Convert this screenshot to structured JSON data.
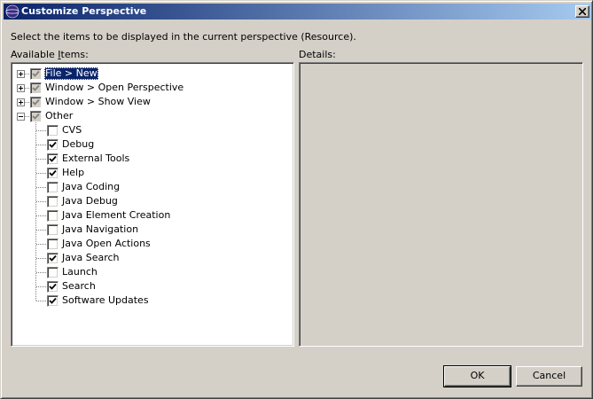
{
  "window": {
    "title": "Customize Perspective",
    "icon": "eclipse-icon"
  },
  "instructions": "Select the items to be displayed in the current perspective (Resource).",
  "available_label": "Available Items:",
  "details_label": "Details:",
  "tree": {
    "top_items": [
      {
        "label": "File > New",
        "expanded": false,
        "state": "grayed-checked",
        "selected": true
      },
      {
        "label": "Window > Open Perspective",
        "expanded": false,
        "state": "grayed-checked",
        "selected": false
      },
      {
        "label": "Window > Show View",
        "expanded": false,
        "state": "grayed-checked",
        "selected": false
      },
      {
        "label": "Other",
        "expanded": true,
        "state": "grayed-checked",
        "selected": false
      }
    ],
    "other_children": [
      {
        "label": "CVS",
        "checked": false
      },
      {
        "label": "Debug",
        "checked": true
      },
      {
        "label": "External Tools",
        "checked": true
      },
      {
        "label": "Help",
        "checked": true
      },
      {
        "label": "Java Coding",
        "checked": false
      },
      {
        "label": "Java Debug",
        "checked": false
      },
      {
        "label": "Java Element Creation",
        "checked": false
      },
      {
        "label": "Java Navigation",
        "checked": false
      },
      {
        "label": "Java Open Actions",
        "checked": false
      },
      {
        "label": "Java Search",
        "checked": true
      },
      {
        "label": "Launch",
        "checked": false
      },
      {
        "label": "Search",
        "checked": true
      },
      {
        "label": "Software Updates",
        "checked": true
      }
    ]
  },
  "buttons": {
    "ok": "OK",
    "cancel": "Cancel"
  },
  "colors": {
    "titlebar_start": "#0a246a",
    "titlebar_end": "#a6caf0",
    "dialog_bg": "#d4d0c8",
    "selection": "#0a246a"
  }
}
